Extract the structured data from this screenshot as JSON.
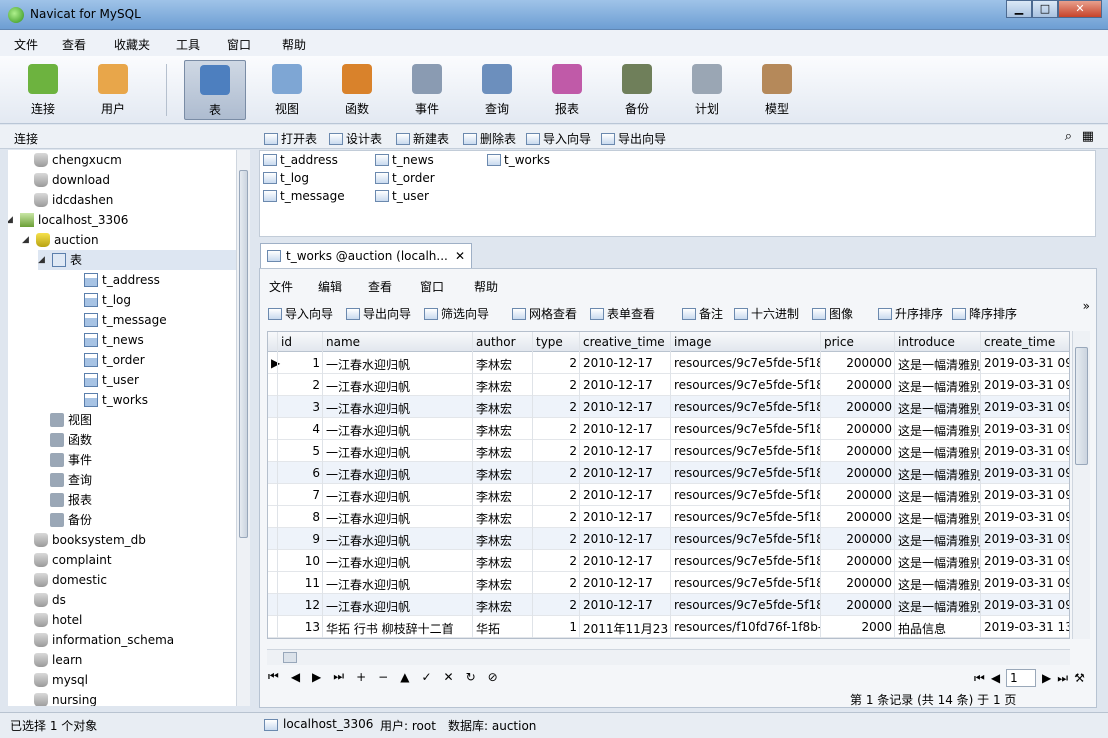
{
  "window": {
    "title": "Navicat for MySQL",
    "btn_min": "▁",
    "btn_max": "□",
    "btn_close": "✕"
  },
  "menu": [
    "文件",
    "查看",
    "收藏夹",
    "工具",
    "窗口",
    "帮助"
  ],
  "toolbar": [
    {
      "label": "连接",
      "icon": "connection-icon",
      "color": "#6db33f"
    },
    {
      "label": "用户",
      "icon": "user-icon",
      "color": "#e8a64a"
    },
    {
      "label": "表",
      "icon": "table-icon",
      "color": "#4d7fbf"
    },
    {
      "label": "视图",
      "icon": "view-icon",
      "color": "#7ea6d4"
    },
    {
      "label": "函数",
      "icon": "function-icon",
      "color": "#d9822b"
    },
    {
      "label": "事件",
      "icon": "event-icon",
      "color": "#8a9bb2"
    },
    {
      "label": "查询",
      "icon": "query-icon",
      "color": "#6c8fbd"
    },
    {
      "label": "报表",
      "icon": "report-icon",
      "color": "#c05aa8"
    },
    {
      "label": "备份",
      "icon": "backup-icon",
      "color": "#6f7f5a"
    },
    {
      "label": "计划",
      "icon": "schedule-icon",
      "color": "#9aa6b4"
    },
    {
      "label": "模型",
      "icon": "model-icon",
      "color": "#b5895a"
    }
  ],
  "connection_label": "连接",
  "object_toolbar": [
    "打开表",
    "设计表",
    "新建表",
    "删除表",
    "导入向导",
    "导出向导"
  ],
  "tree": [
    {
      "label": "chengxucm",
      "level": 1,
      "icon": "db"
    },
    {
      "label": "download",
      "level": 1,
      "icon": "db"
    },
    {
      "label": "idcdashen",
      "level": 1,
      "icon": "db"
    },
    {
      "label": "localhost_3306",
      "level": 0,
      "icon": "srv",
      "arrow": "◢"
    },
    {
      "label": "auction",
      "level": 1,
      "icon": "dbon",
      "arrow": "◢"
    },
    {
      "label": "表",
      "level": 2,
      "icon": "grp",
      "arrow": "◢",
      "selected": true
    },
    {
      "label": "t_address",
      "level": 3,
      "icon": "tbl"
    },
    {
      "label": "t_log",
      "level": 3,
      "icon": "tbl"
    },
    {
      "label": "t_message",
      "level": 3,
      "icon": "tbl"
    },
    {
      "label": "t_news",
      "level": 3,
      "icon": "tbl"
    },
    {
      "label": "t_order",
      "level": 3,
      "icon": "tbl"
    },
    {
      "label": "t_user",
      "level": 3,
      "icon": "tbl"
    },
    {
      "label": "t_works",
      "level": 3,
      "icon": "tbl"
    },
    {
      "label": "视图",
      "level": 2,
      "icon": "obj"
    },
    {
      "label": "函数",
      "level": 2,
      "icon": "obj"
    },
    {
      "label": "事件",
      "level": 2,
      "icon": "obj"
    },
    {
      "label": "查询",
      "level": 2,
      "icon": "obj"
    },
    {
      "label": "报表",
      "level": 2,
      "icon": "obj"
    },
    {
      "label": "备份",
      "level": 2,
      "icon": "obj"
    },
    {
      "label": "booksystem_db",
      "level": 1,
      "icon": "db"
    },
    {
      "label": "complaint",
      "level": 1,
      "icon": "db"
    },
    {
      "label": "domestic",
      "level": 1,
      "icon": "db"
    },
    {
      "label": "ds",
      "level": 1,
      "icon": "db"
    },
    {
      "label": "hotel",
      "level": 1,
      "icon": "db"
    },
    {
      "label": "information_schema",
      "level": 1,
      "icon": "db"
    },
    {
      "label": "learn",
      "level": 1,
      "icon": "db"
    },
    {
      "label": "mysql",
      "level": 1,
      "icon": "db"
    },
    {
      "label": "nursing",
      "level": 1,
      "icon": "db"
    }
  ],
  "object_list": [
    {
      "label": "t_address",
      "col": 0,
      "row": 0
    },
    {
      "label": "t_log",
      "col": 0,
      "row": 1
    },
    {
      "label": "t_message",
      "col": 0,
      "row": 2
    },
    {
      "label": "t_news",
      "col": 1,
      "row": 0
    },
    {
      "label": "t_order",
      "col": 1,
      "row": 1
    },
    {
      "label": "t_user",
      "col": 1,
      "row": 2
    },
    {
      "label": "t_works",
      "col": 2,
      "row": 0
    }
  ],
  "tab": {
    "title": "t_works @auction (localh...",
    "close": "✕"
  },
  "inner_menu": [
    "文件",
    "编辑",
    "查看",
    "窗口",
    "帮助"
  ],
  "inner_toolbar": [
    "导入向导",
    "导出向导",
    "筛选向导",
    "网格查看",
    "表单查看",
    "备注",
    "十六进制",
    "图像",
    "升序排序",
    "降序排序"
  ],
  "columns": [
    "id",
    "name",
    "author",
    "type",
    "creative_time",
    "image",
    "price",
    "introduce",
    "create_time"
  ],
  "rows": [
    [
      "1",
      "一江春水迎归帆",
      "李林宏",
      "2",
      "2010-12-17",
      "resources/9c7e5fde-5f18",
      "200000",
      "这是一幅清雅别",
      "2019-03-31 09:2"
    ],
    [
      "2",
      "一江春水迎归帆",
      "李林宏",
      "2",
      "2010-12-17",
      "resources/9c7e5fde-5f18",
      "200000",
      "这是一幅清雅别",
      "2019-03-31 09:2"
    ],
    [
      "3",
      "一江春水迎归帆",
      "李林宏",
      "2",
      "2010-12-17",
      "resources/9c7e5fde-5f18",
      "200000",
      "这是一幅清雅别",
      "2019-03-31 09:2"
    ],
    [
      "4",
      "一江春水迎归帆",
      "李林宏",
      "2",
      "2010-12-17",
      "resources/9c7e5fde-5f18",
      "200000",
      "这是一幅清雅别",
      "2019-03-31 09:2"
    ],
    [
      "5",
      "一江春水迎归帆",
      "李林宏",
      "2",
      "2010-12-17",
      "resources/9c7e5fde-5f18",
      "200000",
      "这是一幅清雅别",
      "2019-03-31 09:2"
    ],
    [
      "6",
      "一江春水迎归帆",
      "李林宏",
      "2",
      "2010-12-17",
      "resources/9c7e5fde-5f18",
      "200000",
      "这是一幅清雅别",
      "2019-03-31 09:2"
    ],
    [
      "7",
      "一江春水迎归帆",
      "李林宏",
      "2",
      "2010-12-17",
      "resources/9c7e5fde-5f18",
      "200000",
      "这是一幅清雅别",
      "2019-03-31 09:2"
    ],
    [
      "8",
      "一江春水迎归帆",
      "李林宏",
      "2",
      "2010-12-17",
      "resources/9c7e5fde-5f18",
      "200000",
      "这是一幅清雅别",
      "2019-03-31 09:2"
    ],
    [
      "9",
      "一江春水迎归帆",
      "李林宏",
      "2",
      "2010-12-17",
      "resources/9c7e5fde-5f18",
      "200000",
      "这是一幅清雅别",
      "2019-03-31 09:2"
    ],
    [
      "10",
      "一江春水迎归帆",
      "李林宏",
      "2",
      "2010-12-17",
      "resources/9c7e5fde-5f18",
      "200000",
      "这是一幅清雅别",
      "2019-03-31 09:2"
    ],
    [
      "11",
      "一江春水迎归帆",
      "李林宏",
      "2",
      "2010-12-17",
      "resources/9c7e5fde-5f18",
      "200000",
      "这是一幅清雅别",
      "2019-03-31 09:2"
    ],
    [
      "12",
      "一江春水迎归帆",
      "李林宏",
      "2",
      "2010-12-17",
      "resources/9c7e5fde-5f18",
      "200000",
      "这是一幅清雅别",
      "2019-03-31 09:2"
    ],
    [
      "13",
      "华拓 行书 柳枝辞十二首",
      "华拓",
      "1",
      "2011年11月23日",
      "resources/f10fd76f-1f8b-",
      "2000",
      "拍品信息",
      "2019-03-31 13:0"
    ]
  ],
  "nav_buttons": [
    "⏮",
    "◀",
    "▶",
    "⏭",
    "+",
    "−",
    "▲",
    "✓",
    "✕",
    "↻",
    "⊘"
  ],
  "record_status": "第 1 条记录 (共 14 条) 于 1 页",
  "page_input": "1",
  "status": {
    "left": "已选择 1 个对象",
    "server": "localhost_3306",
    "user": "用户: root",
    "db": "数据库: auction"
  }
}
